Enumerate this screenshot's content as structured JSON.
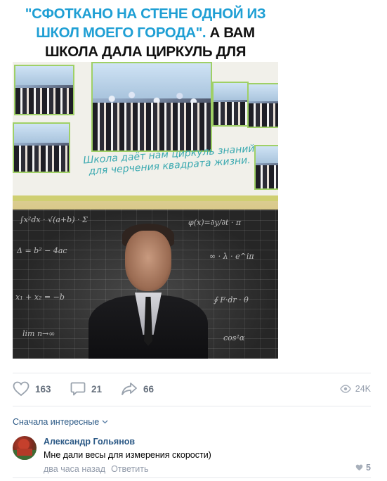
{
  "post": {
    "caption_quote": "\"Сфоткано на стене одной из школ моего города\".",
    "caption_rest": "А вам школа дала циркуль для квадрата?",
    "banner_slogan": "Школа даёт нам циркуль знаний для черчения квадрата жизни."
  },
  "actions": {
    "likes": "163",
    "comments": "21",
    "shares": "66",
    "views": "24K"
  },
  "comments_section": {
    "sort_label": "Сначала интересные",
    "items": [
      {
        "author": "Александр Гольянов",
        "text": "Мне дали весы для измерения скорости)",
        "time": "два часа назад",
        "reply_label": "Ответить",
        "likes": "5"
      }
    ]
  },
  "colors": {
    "accent_link": "#2a5885",
    "caption_blue": "#1f9fd4",
    "muted": "#939cab"
  }
}
